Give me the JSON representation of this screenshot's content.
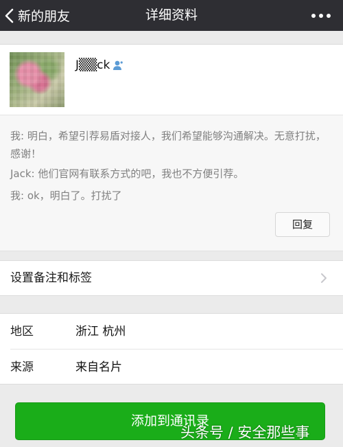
{
  "nav": {
    "back_label": "新的朋友",
    "title": "详细资料",
    "back_icon": "chevron-left-icon",
    "more_icon": "more-dots-icon"
  },
  "profile": {
    "nickname": "J▒▒ck",
    "contact_icon": "contact-person-icon"
  },
  "messages": [
    "我: 明白，希望引荐易盾对接人，我们希望能够沟通解决。无意打扰，感谢！",
    "Jack: 他们官网有联系方式的吧，我也不方便引荐。",
    "我: ok，明白了。打扰了"
  ],
  "reply_label": "回复",
  "remark_tag_label": "设置备注和标签",
  "info": [
    {
      "key": "地区",
      "value": "浙江  杭州"
    },
    {
      "key": "来源",
      "value": "来自名片"
    }
  ],
  "add_button_label": "添加到通讯录",
  "watermark": "头条号 / 安全那些事",
  "colors": {
    "nav_bg": "#2e2e33",
    "primary_green": "#1aad19",
    "contact_icon_blue": "#5b9bd5",
    "message_text": "#808080",
    "page_bg": "#ebebeb"
  }
}
